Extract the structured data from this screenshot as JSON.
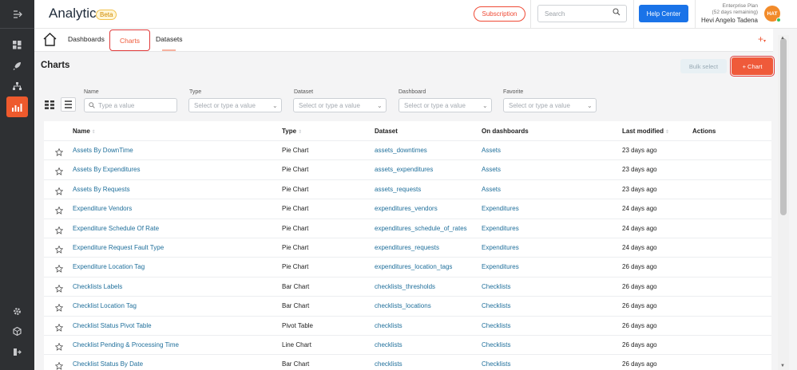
{
  "header": {
    "title": "Analytics",
    "badge": "Beta",
    "subscription_label": "Subscription",
    "search_placeholder": "Search",
    "help_label": "Help Center",
    "plan_line1": "Enterprise Plan",
    "plan_line2": "(52 days remaining)",
    "user_name": "Hevi Angelo Tadena",
    "avatar_initials": "HAT"
  },
  "tabs": {
    "dashboards": "Dashboards",
    "charts": "Charts",
    "datasets": "Datasets",
    "add": "+"
  },
  "page": {
    "title": "Charts",
    "bulk_select_label": "Bulk select",
    "add_chart_label": "+ Chart"
  },
  "filters": {
    "name_label": "Name",
    "name_placeholder": "Type a value",
    "type_label": "Type",
    "type_placeholder": "Select or type a value",
    "dataset_label": "Dataset",
    "dataset_placeholder": "Select or type a value",
    "dashboard_label": "Dashboard",
    "dashboard_placeholder": "Select or type a value",
    "favorite_label": "Favorite",
    "favorite_placeholder": "Select or type a value"
  },
  "table": {
    "columns": {
      "name": "Name",
      "type": "Type",
      "dataset": "Dataset",
      "dashboards": "On dashboards",
      "modified": "Last modified",
      "actions": "Actions"
    },
    "rows": [
      {
        "name": "Assets By DownTime",
        "type": "Pie Chart",
        "dataset": "assets_downtimes",
        "dashboard": "Assets",
        "modified": "23 days ago"
      },
      {
        "name": "Assets By Expenditures",
        "type": "Pie Chart",
        "dataset": "assets_expenditures",
        "dashboard": "Assets",
        "modified": "23 days ago"
      },
      {
        "name": "Assets By Requests",
        "type": "Pie Chart",
        "dataset": "assets_requests",
        "dashboard": "Assets",
        "modified": "23 days ago"
      },
      {
        "name": "Expenditure Vendors",
        "type": "Pie Chart",
        "dataset": "expenditures_vendors",
        "dashboard": "Expenditures",
        "modified": "24 days ago"
      },
      {
        "name": "Expenditure Schedule Of Rate",
        "type": "Pie Chart",
        "dataset": "expenditures_schedule_of_rates",
        "dashboard": "Expenditures",
        "modified": "24 days ago"
      },
      {
        "name": "Expenditure Request Fault Type",
        "type": "Pie Chart",
        "dataset": "expenditures_requests",
        "dashboard": "Expenditures",
        "modified": "24 days ago"
      },
      {
        "name": "Expenditure Location Tag",
        "type": "Pie Chart",
        "dataset": "expenditures_location_tags",
        "dashboard": "Expenditures",
        "modified": "26 days ago"
      },
      {
        "name": "Checklists Labels",
        "type": "Bar Chart",
        "dataset": "checklists_thresholds",
        "dashboard": "Checklists",
        "modified": "26 days ago"
      },
      {
        "name": "Checklist Location Tag",
        "type": "Bar Chart",
        "dataset": "checklists_locations",
        "dashboard": "Checklists",
        "modified": "26 days ago"
      },
      {
        "name": "Checklist Status Pivot Table",
        "type": "Pivot Table",
        "dataset": "checklists",
        "dashboard": "Checklists",
        "modified": "26 days ago"
      },
      {
        "name": "Checklist Pending & Processing Time",
        "type": "Line Chart",
        "dataset": "checklists",
        "dashboard": "Checklists",
        "modified": "26 days ago"
      },
      {
        "name": "Checklist Status By Date",
        "type": "Bar Chart",
        "dataset": "checklists",
        "dashboard": "Checklists",
        "modified": "26 days ago"
      }
    ]
  },
  "colors": {
    "accent": "#ef5a3a",
    "link": "#1f6f9b",
    "rail": "#2e3033",
    "help": "#1a73e8"
  }
}
